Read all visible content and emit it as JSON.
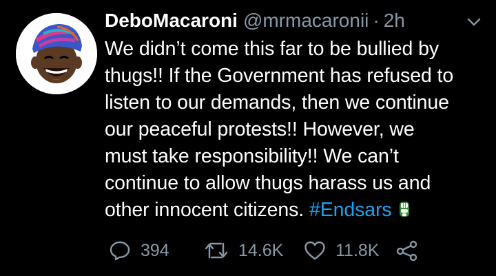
{
  "tweet": {
    "author": {
      "display_name": "DeboMacaroni",
      "handle": "@mrmacaronii",
      "separator": "·",
      "timestamp": "2h",
      "avatar_icon": "cartoon-man-avatar"
    },
    "body_lines": [
      "We didn’t come this far to be bullied by",
      "thugs!! If the Government has refused to",
      "listen to our demands, then we continue",
      "our peaceful protests!! However, we",
      "must take responsibility!! We can’t",
      "continue to allow thugs harass us and",
      "other innocent citizens."
    ],
    "hashtag": "#Endsars",
    "emoji": "raised-fist-icon",
    "actions": {
      "replies": "394",
      "retweets": "14.6K",
      "likes": "11.8K"
    },
    "colors": {
      "background": "#000000",
      "text": "#ffffff",
      "secondary": "#8899a6",
      "link": "#1da1f2"
    }
  }
}
